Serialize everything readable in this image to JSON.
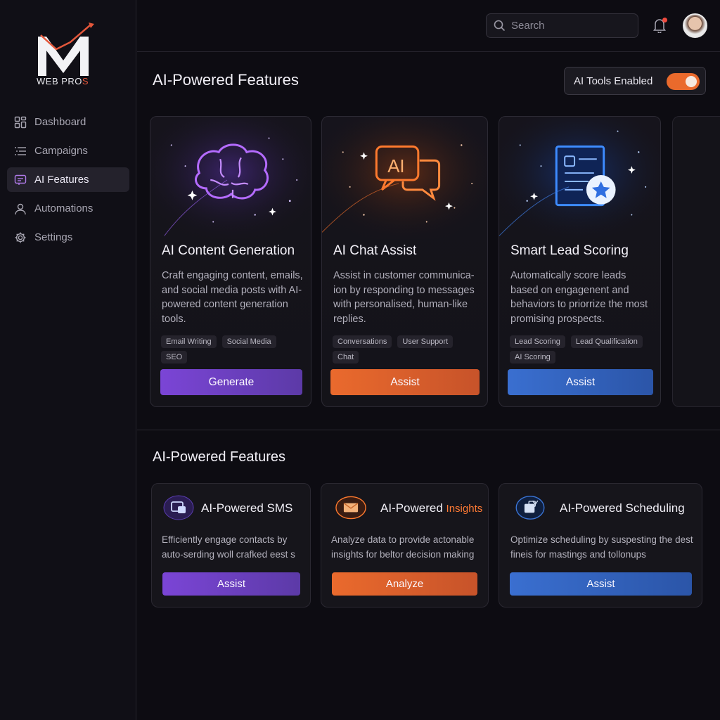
{
  "brand": {
    "logo_letter": "M",
    "name_main": "WEB PRO",
    "name_accent": "S",
    "accent_color": "#e4573b"
  },
  "sidebar": {
    "items": [
      {
        "label": "Dashboard",
        "icon": "grid-icon",
        "active": false
      },
      {
        "label": "Campaigns",
        "icon": "list-icon",
        "active": false
      },
      {
        "label": "AI Features",
        "icon": "chat-screen-icon",
        "active": true
      },
      {
        "label": "Automations",
        "icon": "user-icon",
        "active": false
      },
      {
        "label": "Settings",
        "icon": "gear-icon",
        "active": false
      }
    ]
  },
  "header": {
    "search_placeholder": "Search",
    "notification_dot": true
  },
  "main": {
    "title": "AI-Powered Features",
    "toggle": {
      "label": "AI Tools Enabled",
      "on": true,
      "color": "#ea6a2c"
    },
    "cards": [
      {
        "title": "AI Content Generation",
        "description": "Craft engaging content, emails, and social media posts with AI-powered content generation tools.",
        "tags": [
          "Email Writing",
          "Social Media",
          "SEO"
        ],
        "button": "Generate",
        "icon": "brain-icon",
        "color": "#8b4be0"
      },
      {
        "title": "AI Chat Assist",
        "description": "Assist in customer communica-ion by responding to messages with personalised, human-like replies.",
        "tags": [
          "Conversations",
          "User Support",
          "Chat"
        ],
        "button": "Assist",
        "icon": "ai-chat-bubble-icon",
        "color": "#ea6a2d"
      },
      {
        "title": "Smart Lead Scoring",
        "description": "Automatically score leads based on engagenent and behaviors to priorrize the most promising prospects.",
        "tags": [
          "Lead Scoring",
          "Lead Qualification",
          "AI Scoring"
        ],
        "button": "Assist",
        "icon": "lead-card-star-icon",
        "color": "#3a6fd0"
      }
    ]
  },
  "secondary": {
    "title": "AI-Powered Features",
    "cards": [
      {
        "title": "AI-Powered SMS",
        "title_accent": "",
        "description": "Efficiently engage contacts by auto-serding woll crafked eest s",
        "button": "Assist",
        "icon": "sms-icon"
      },
      {
        "title": "AI-Powered ",
        "title_accent": "Insights",
        "description": "Analyze data to provide actonable insights for beltor decision making",
        "button": "Analyze",
        "icon": "mail-insight-icon"
      },
      {
        "title": "AI-Powered Scheduling",
        "title_accent": "",
        "description": "Optimize scheduling by suspesting the dest fineis for mastings and tollonups",
        "button": "Assist",
        "icon": "schedule-icon"
      }
    ]
  }
}
